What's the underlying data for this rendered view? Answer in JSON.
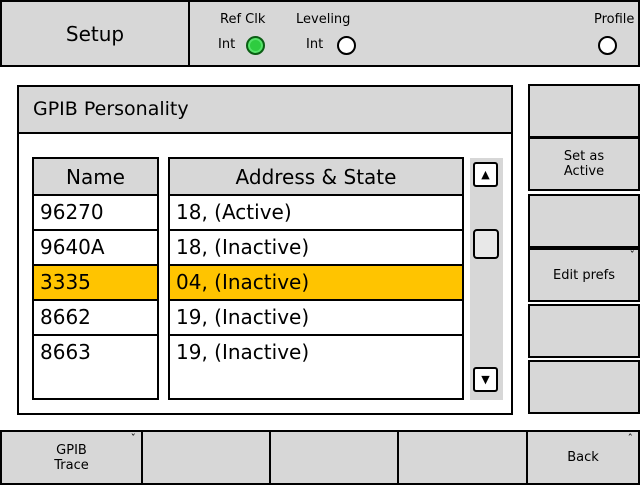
{
  "header": {
    "title": "Setup",
    "ref_clk": {
      "label": "Ref Clk",
      "value": "Int",
      "active": true
    },
    "leveling": {
      "label": "Leveling",
      "value": "Int",
      "active": false
    },
    "profile": {
      "label": "Profile",
      "active": false
    }
  },
  "panel": {
    "title": "GPIB Personality",
    "columns": {
      "name": "Name",
      "address_state": "Address & State"
    },
    "rows": [
      {
        "name": "96270",
        "address_state": "18, (Active)",
        "selected": false
      },
      {
        "name": "9640A",
        "address_state": "18, (Inactive)",
        "selected": false
      },
      {
        "name": "3335",
        "address_state": "04, (Inactive)",
        "selected": true
      },
      {
        "name": "8662",
        "address_state": "19, (Inactive)",
        "selected": false
      },
      {
        "name": "8663",
        "address_state": "19, (Inactive)",
        "selected": false
      }
    ]
  },
  "right_keys": [
    {
      "label": ""
    },
    {
      "label": "Set as Active"
    },
    {
      "label": ""
    },
    {
      "label": "Edit prefs"
    },
    {
      "label": ""
    },
    {
      "label": ""
    }
  ],
  "bottom_keys": [
    {
      "label": "GPIB Trace"
    },
    {
      "label": ""
    },
    {
      "label": ""
    },
    {
      "label": ""
    },
    {
      "label": "Back"
    }
  ],
  "icons": {
    "scroll_up": "up-arrow-icon",
    "scroll_down": "down-arrow-icon",
    "submenu": "chevron-icon",
    "led_on_color": "#2ecc40",
    "selection_color": "#ffc400"
  }
}
